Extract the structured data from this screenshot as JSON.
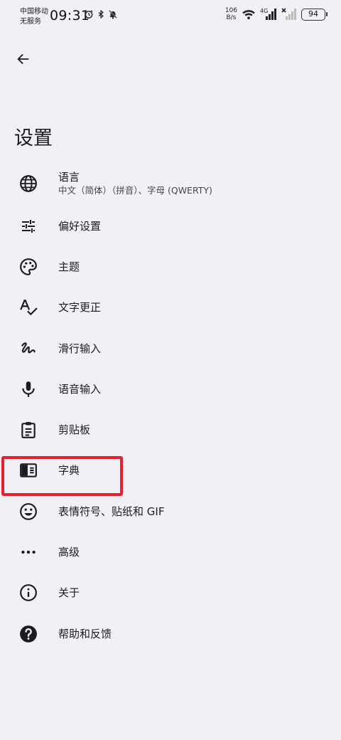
{
  "status_bar": {
    "carrier_line1": "中国移动",
    "carrier_line2": "无服务",
    "time": "09:31",
    "net_speed_value": "106",
    "net_speed_unit": "B/s",
    "network_type": "4G",
    "battery": "94"
  },
  "app_bar": {
    "back_icon": "arrow-back-icon",
    "title": "设置"
  },
  "settings": {
    "items": [
      {
        "icon": "globe-icon",
        "label": "语言",
        "subtitle": "中文（简体）（拼音）、字母 (QWERTY)"
      },
      {
        "icon": "tune-icon",
        "label": "偏好设置"
      },
      {
        "icon": "palette-icon",
        "label": "主题"
      },
      {
        "icon": "spellcheck-icon",
        "label": "文字更正"
      },
      {
        "icon": "gesture-icon",
        "label": "滑行输入"
      },
      {
        "icon": "mic-icon",
        "label": "语音输入"
      },
      {
        "icon": "clipboard-icon",
        "label": "剪贴板"
      },
      {
        "icon": "dictionary-icon",
        "label": "字典"
      },
      {
        "icon": "emoji-icon",
        "label": "表情符号、贴纸和 GIF"
      },
      {
        "icon": "more-horiz-icon",
        "label": "高级"
      },
      {
        "icon": "info-icon",
        "label": "关于"
      },
      {
        "icon": "help-icon",
        "label": "帮助和反馈"
      }
    ]
  },
  "annotation": {
    "highlight_color": "#e8202e"
  }
}
